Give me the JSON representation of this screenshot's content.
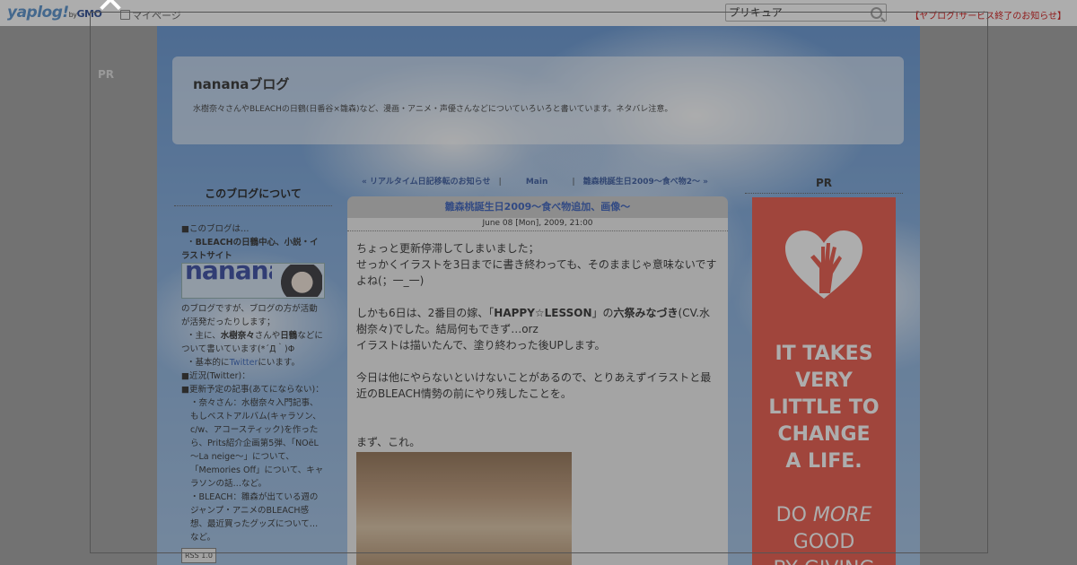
{
  "topbar": {
    "logo_text": "yaplog!",
    "logo_by": "by",
    "logo_gmo": "GMO",
    "mypage_label": "マイページ",
    "search_value": "プリキュア",
    "notice_text": "【ヤプログ!サービス終了のお知らせ】"
  },
  "pr_left": "PR",
  "header": {
    "title": "nananaブログ",
    "description": "水樹奈々さんやBLEACHの日鶴(日番谷×雛森)など、漫画・アニメ・声優さんなどについていろいろと書いています。ネタバレ注意。"
  },
  "nav": {
    "prev": "« リアルタイム日記移転のお知らせ",
    "main": "Main",
    "next": "雛森桃誕生日2009～食べ物2～ »",
    "sep": "|"
  },
  "sidebar": {
    "title": "このブログについて",
    "line1": "■このブログは…",
    "line2a": "・",
    "line2b": "BLEACHの日鶴中心、小説・イラストサイト",
    "banner_text": "nanana",
    "line3": "のブログですが、ブログの方が活動が活発だったりします；",
    "line4a": "・主に、",
    "line4b": "水樹奈々",
    "line4c": "さんや",
    "line4d": "日鶴",
    "line4e": "などについて書いています(*´Д｀)Φ",
    "line5a": "・基本的に",
    "line5b": "Twitter",
    "line5c": "にいます。",
    "line6": "■近況(Twitter)：",
    "line7": "■更新予定の記事(あてにならない)：",
    "line8": "・奈々さん：水樹奈々入門記事、もしベストアルバム(キャラソン、c/w、アコースティック)を作ったら、Prits紹介企画第5弾、「NOëL～La neige～」について、「Memories Off」について、キャラソンの話…など。",
    "line9": "・BLEACH：雛森が出ている週のジャンプ・アニメのBLEACH感想、最近買ったグッズについて…など。",
    "rss": "RSS 1.0"
  },
  "post": {
    "title": "雛森桃誕生日2009～食べ物追加、画像～",
    "date": "June 08 [Mon], 2009, 21:00",
    "p1a": "ちょっと更新停滞してしまいました；",
    "p1b": "せっかくイラストを3日までに書き終わっても、そのままじゃ意味ないですよね(；一_一)",
    "p2a": "しかも6日は、2番目の嫁、「",
    "p2b": "HAPPY☆LESSON",
    "p2c": "」の",
    "p2d": "六祭みなづき",
    "p2e": "(CV.水樹奈々)でした。結局何もできず…orz",
    "p2f": "イラストは描いたんで、塗り終わった後UPします。",
    "p3": "今日は他にやらないといけないことがあるので、とりあえずイラストと最近のBLEACH情勢の前にやり残したことを。",
    "p4": "まず、これ。"
  },
  "pr_right": {
    "title": "PR",
    "ad_line1": [
      "IT TAKES",
      "VERY",
      "LITTLE TO",
      "CHANGE",
      "A LIFE."
    ],
    "ad_line2a": "DO ",
    "ad_line2b": "MORE",
    "ad_line3": "GOOD",
    "ad_line4": "BY GIVING",
    "ad_color": "#e84c3d"
  },
  "overlay": {
    "close_symbol": "✕"
  }
}
